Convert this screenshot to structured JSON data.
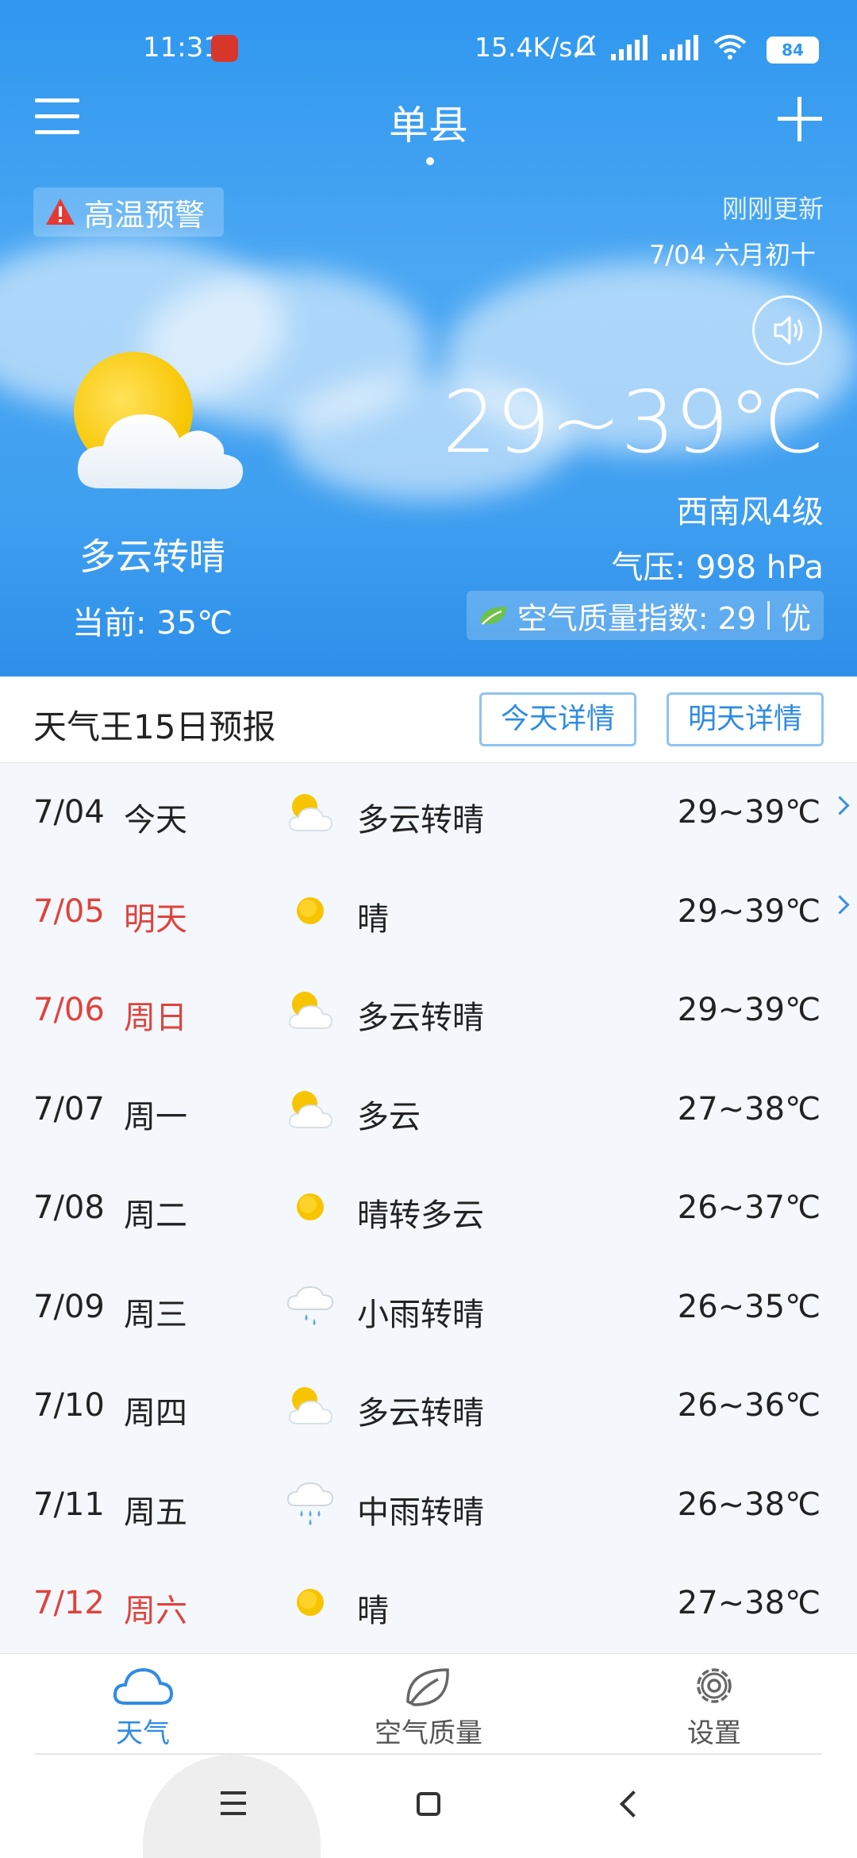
{
  "status_bar": {
    "time": "11:31",
    "net_speed": "15.4K/s",
    "battery": "84",
    "icons": [
      "app-icon",
      "mute-icon",
      "hd-signal-icon",
      "hd-signal-icon",
      "wifi-icon",
      "battery-icon"
    ]
  },
  "header": {
    "city": "单县",
    "menu_icon": "menu-icon",
    "add_icon": "plus-icon"
  },
  "alert": {
    "label": "高温预警",
    "icon": "warning-icon"
  },
  "update": {
    "status": "刚刚更新",
    "date": "7/04 六月初十"
  },
  "today": {
    "condition": "多云转晴",
    "current": "当前: 35℃",
    "temp_range": "29~39℃",
    "wind": "西南风4级",
    "pressure": "气压: 998 hPa",
    "aqi_label": "空气质量指数: 29",
    "aqi_level": "优"
  },
  "forecast": {
    "title": "天气王15日预报",
    "today_btn": "今天详情",
    "tomorrow_btn": "明天详情",
    "rows": [
      {
        "date": "7/04",
        "day": "今天",
        "icon": "partly-cloudy-icon",
        "cond": "多云转晴",
        "temp": "29~39℃",
        "red": false,
        "chevron": true
      },
      {
        "date": "7/05",
        "day": "明天",
        "icon": "sunny-icon",
        "cond": "晴",
        "temp": "29~39℃",
        "red": true,
        "chevron": true
      },
      {
        "date": "7/06",
        "day": "周日",
        "icon": "partly-cloudy-icon",
        "cond": "多云转晴",
        "temp": "29~39℃",
        "red": true,
        "chevron": false
      },
      {
        "date": "7/07",
        "day": "周一",
        "icon": "partly-cloudy-icon",
        "cond": "多云",
        "temp": "27~38℃",
        "red": false,
        "chevron": false
      },
      {
        "date": "7/08",
        "day": "周二",
        "icon": "sunny-icon",
        "cond": "晴转多云",
        "temp": "26~37℃",
        "red": false,
        "chevron": false
      },
      {
        "date": "7/09",
        "day": "周三",
        "icon": "light-rain-icon",
        "cond": "小雨转晴",
        "temp": "26~35℃",
        "red": false,
        "chevron": false
      },
      {
        "date": "7/10",
        "day": "周四",
        "icon": "partly-cloudy-icon",
        "cond": "多云转晴",
        "temp": "26~36℃",
        "red": false,
        "chevron": false
      },
      {
        "date": "7/11",
        "day": "周五",
        "icon": "moderate-rain-icon",
        "cond": "中雨转晴",
        "temp": "26~38℃",
        "red": false,
        "chevron": false
      },
      {
        "date": "7/12",
        "day": "周六",
        "icon": "sunny-icon",
        "cond": "晴",
        "temp": "27~38℃",
        "red": true,
        "chevron": false
      }
    ]
  },
  "bottom_nav": {
    "weather": "天气",
    "air": "空气质量",
    "settings": "设置"
  },
  "colors": {
    "accent": "#2f8be4",
    "weekend_red": "#e0423c",
    "hero_blue": "#3f9ff0"
  }
}
